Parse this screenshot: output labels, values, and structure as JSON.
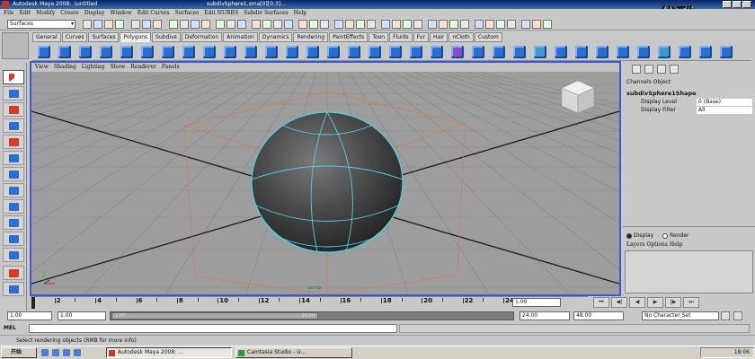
{
  "titlebar": {
    "title": "Autodesk Maya 2008: .\\untitled",
    "file": "subdivSphere1.sma[0][0:3]..."
  },
  "watermark": "优酷",
  "menubar": [
    "File",
    "Edit",
    "Modify",
    "Create",
    "Display",
    "Window",
    "Edit Curves",
    "Surfaces",
    "Edit NURBS",
    "Subdiv Surfaces",
    "Help"
  ],
  "statusline": {
    "mode": "Surfaces"
  },
  "shelf": {
    "tabs": [
      "General",
      "Curves",
      "Surfaces",
      "Polygons",
      "Subdivs",
      "Deformation",
      "Animation",
      "Dynamics",
      "Rendering",
      "PaintEffects",
      "Toon",
      "Fluids",
      "Fur",
      "Hair",
      "nCloth",
      "Custom"
    ],
    "active_tab": "Polygons"
  },
  "viewport": {
    "menu": [
      "View",
      "Shading",
      "Lighting",
      "Show",
      "Renderer",
      "Panels"
    ],
    "camera_label": "persp",
    "wire_color": "#4fd0e0",
    "bbox_color": "#d08050"
  },
  "channelbox": {
    "menu": "Channels  Object",
    "node": "subdivSphere1Shape",
    "rows": [
      {
        "label": "Display Level",
        "value": "0 (Base)"
      },
      {
        "label": "Display Filter",
        "value": "All"
      }
    ]
  },
  "layereditor": {
    "radio": [
      {
        "label": "Display",
        "on": true
      },
      {
        "label": "Render",
        "on": false
      }
    ],
    "menu": "Layers  Options  Help"
  },
  "timeslider": {
    "ticks": [
      "2",
      "4",
      "6",
      "8",
      "10",
      "12",
      "14",
      "16",
      "18",
      "20",
      "22",
      "24"
    ],
    "current_frame": "1.00"
  },
  "rangeslider": {
    "start": "1.00",
    "playback_start": "1.00",
    "handle_left": "1.00",
    "handle_right": "24.00",
    "playback_end": "24.00",
    "end": "48.00",
    "character_set": "No Character Set"
  },
  "cmdline": {
    "label": "MEL"
  },
  "helpline": "Select rendering objects (RMB for more info)",
  "taskbar": {
    "start": "开始",
    "tasks": [
      {
        "label": "Autodesk Maya 2008: ...",
        "active": true
      },
      {
        "label": "Camtasia Studio - U...",
        "active": false
      }
    ],
    "clock": "18:06"
  }
}
